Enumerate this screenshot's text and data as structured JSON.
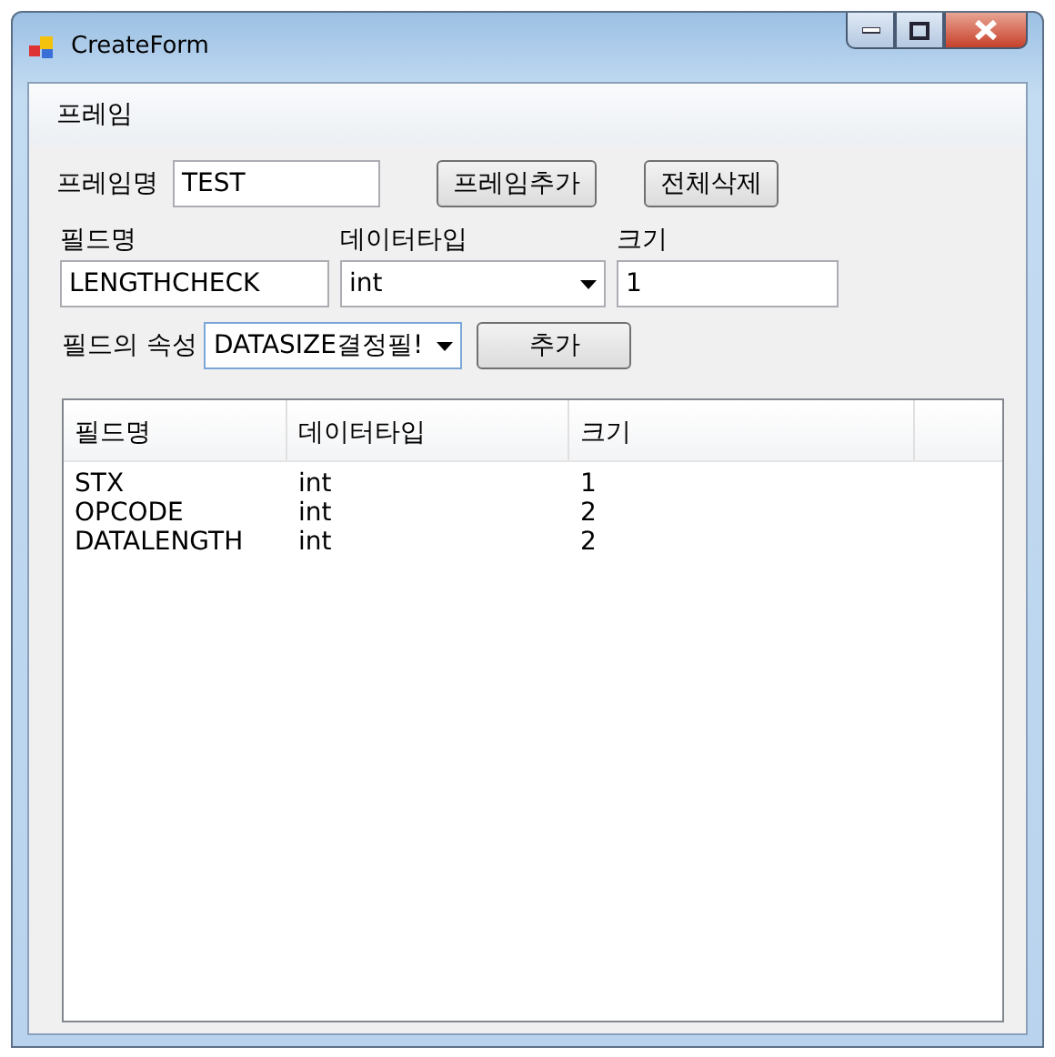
{
  "window": {
    "title": "CreateForm"
  },
  "menu": [
    "프레임"
  ],
  "frame": {
    "label": "프레임명",
    "value": "TEST",
    "add_button": "프레임추가",
    "clear_button": "전체삭제"
  },
  "field": {
    "name_label": "필드명",
    "name_value": "LENGTHCHECK",
    "type_label": "데이터타입",
    "type_value": "int",
    "size_label": "크기",
    "size_value": "1"
  },
  "attribute": {
    "label": "필드의 속성",
    "value": "DATASIZE결정필!",
    "add_button": "추가"
  },
  "table": {
    "columns": [
      "필드명",
      "데이터타입",
      "크기"
    ],
    "rows": [
      [
        "STX",
        "int",
        "1"
      ],
      [
        "OPCODE",
        "int",
        "2"
      ],
      [
        "DATALENGTH",
        "int",
        "2"
      ]
    ]
  }
}
